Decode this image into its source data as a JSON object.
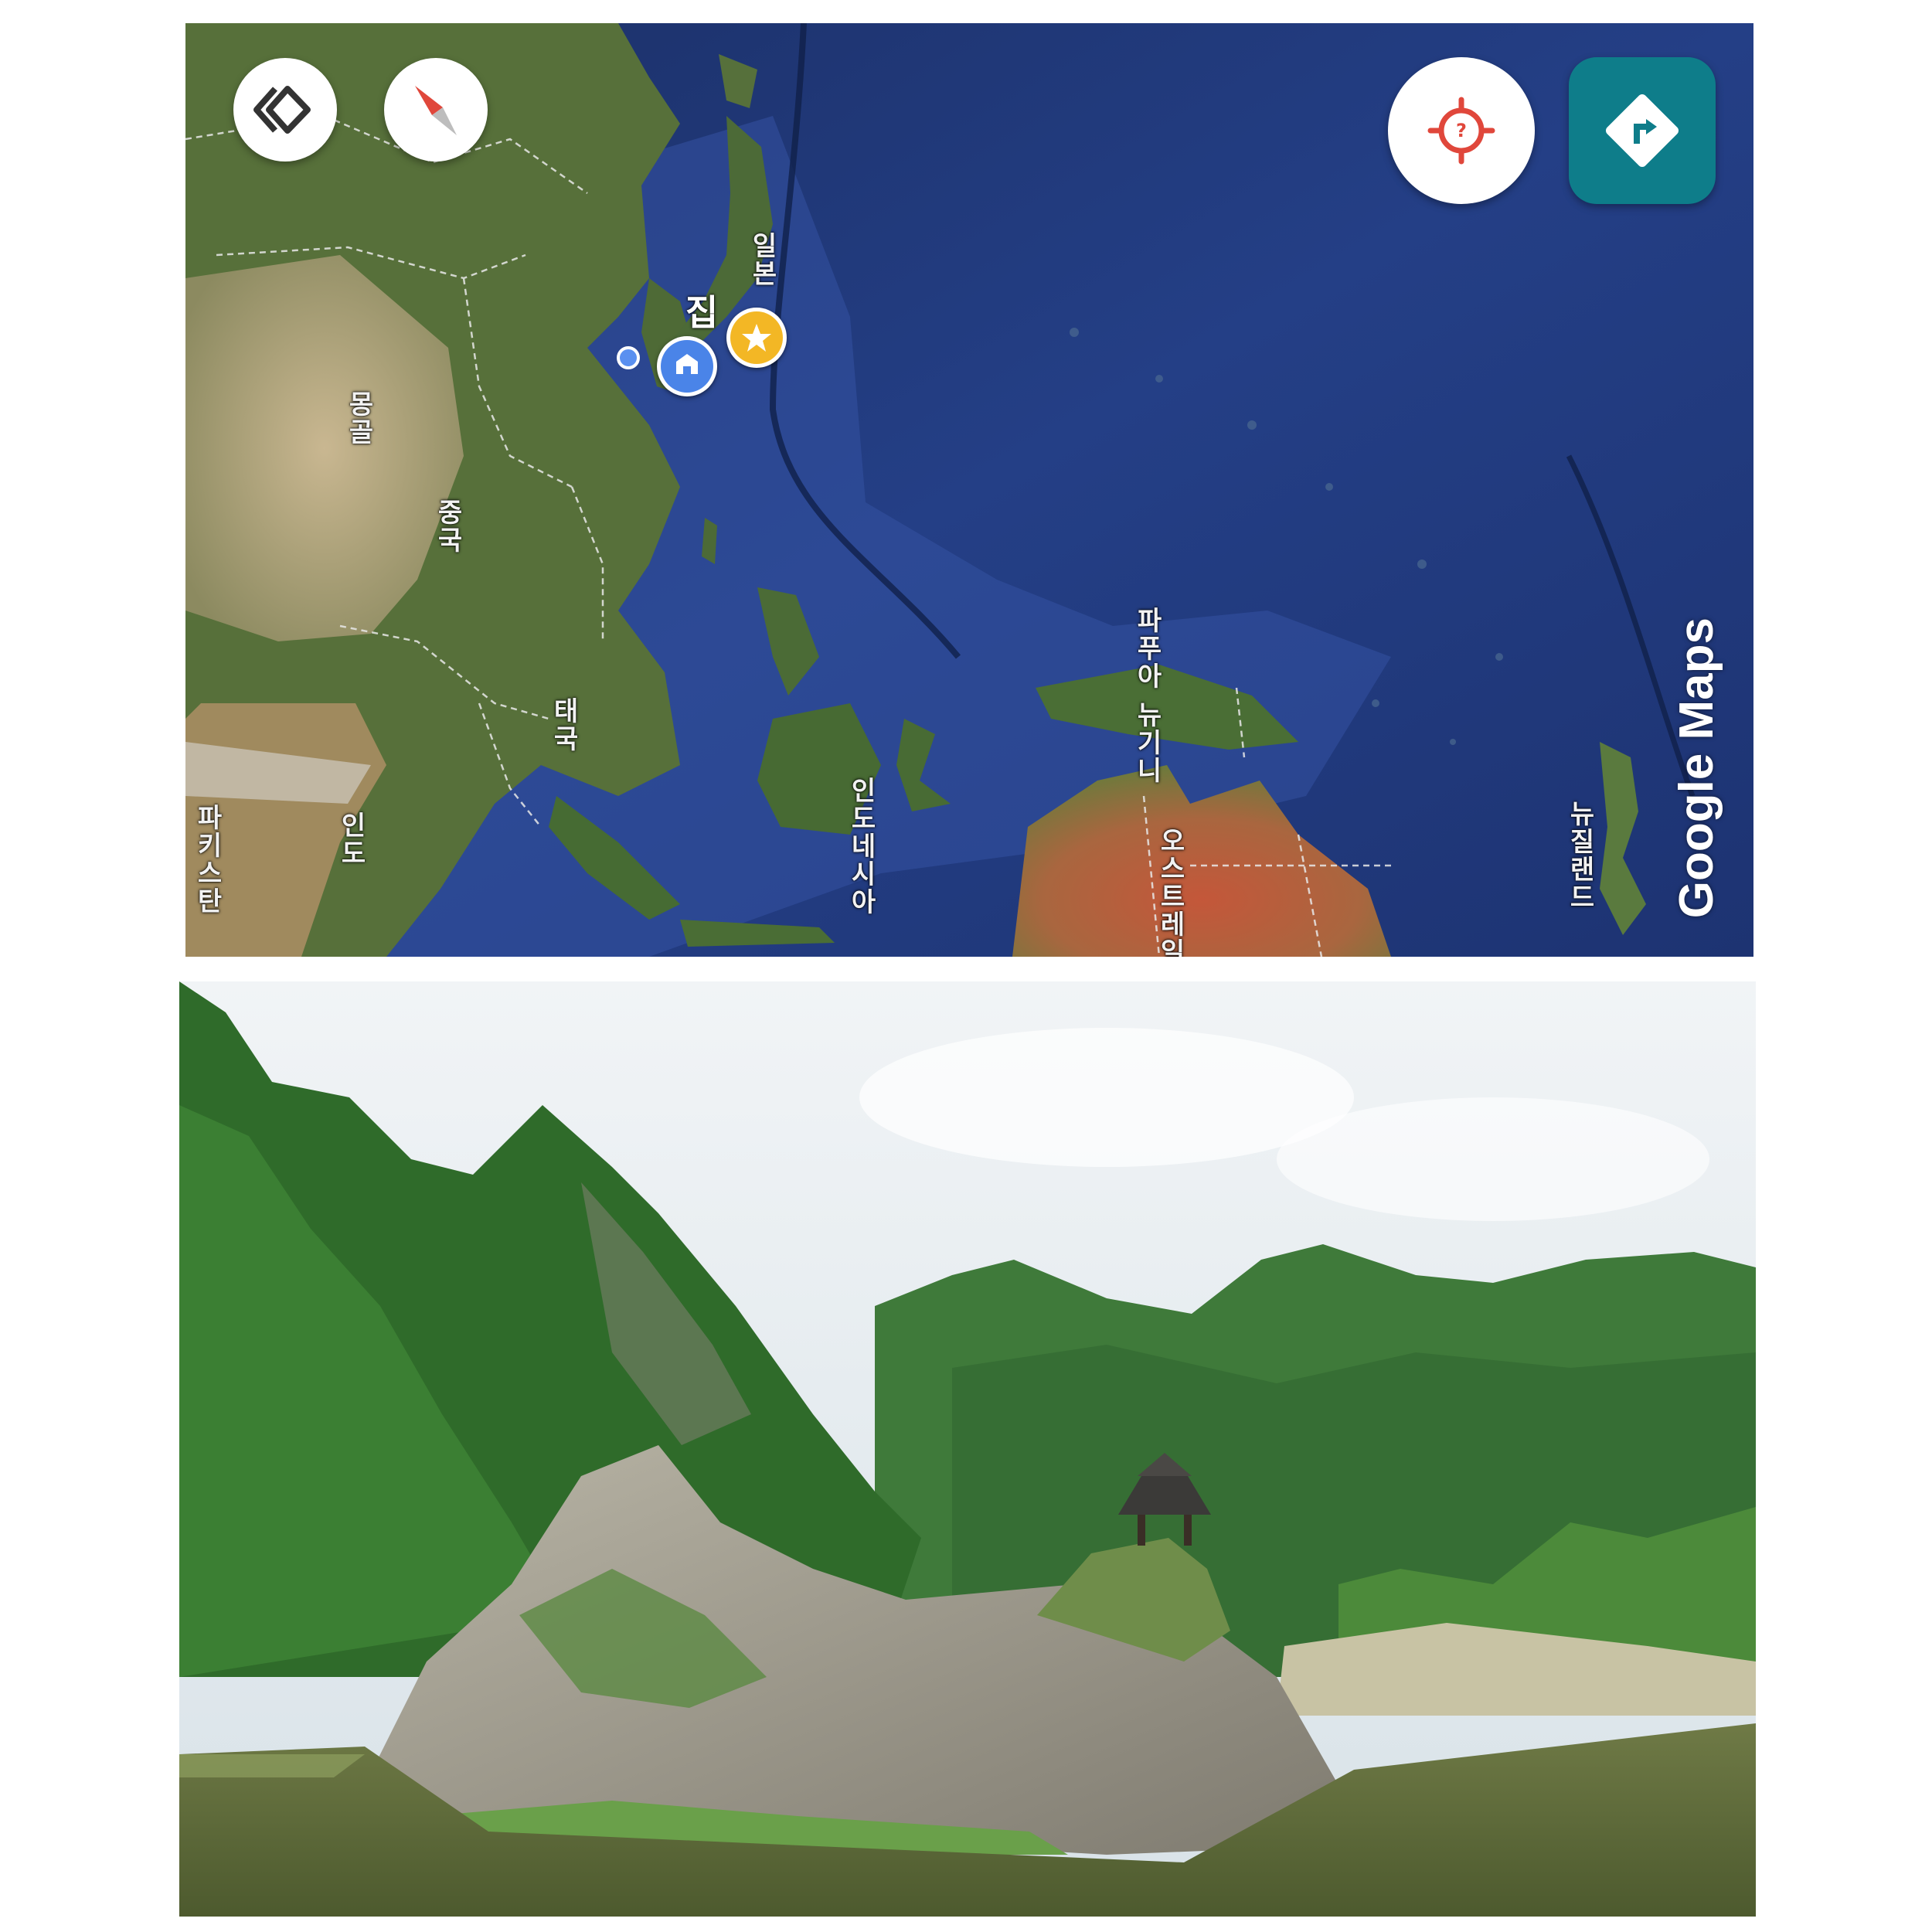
{
  "map": {
    "labels": {
      "home": "집",
      "japan": "일본",
      "mongolia": "몽골",
      "china": "중국",
      "thailand": "태국",
      "pakistan": "파키스탄",
      "india": "인도",
      "indonesia": "인도네시아",
      "papua_new_guinea": "파푸아 뉴기니",
      "australia": "오스트레일리아",
      "new_zealand": "뉴질랜드"
    },
    "watermark": "Google Maps",
    "icons": {
      "layers": "layers-icon",
      "compass": "compass-icon",
      "locate": "locate-icon",
      "directions": "directions-icon",
      "home_pin": "home-pin-icon",
      "saved_pin": "star-pin-icon",
      "current_location": "current-location-dot"
    },
    "colors": {
      "directions_button": "#0e7d8a",
      "home_pin": "#4a84e8",
      "saved_pin": "#f3b725",
      "locate_icon": "#e0473b",
      "compass_needle": "#e0473b"
    }
  },
  "photo": {}
}
